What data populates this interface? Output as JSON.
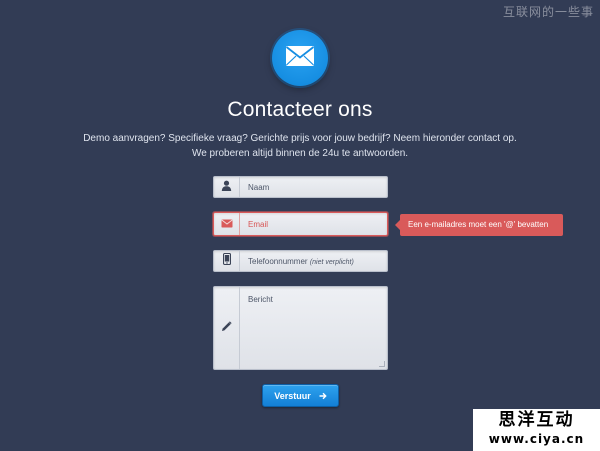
{
  "watermark": {
    "top_text": "互联网的一些事",
    "box_line1": "思洋互动",
    "box_line2": "www.ciya.cn"
  },
  "header": {
    "icon": "envelope-icon",
    "title": "Contacteer ons",
    "intro_line1": "Demo aanvragen? Specifieke vraag? Gerichte prijs voor jouw bedrijf? Neem hieronder contact op.",
    "intro_line2": "We proberen altijd binnen de 24u te antwoorden."
  },
  "form": {
    "name": {
      "placeholder": "Naam",
      "icon": "user-icon"
    },
    "email": {
      "placeholder": "Email",
      "icon": "envelope-icon",
      "state": "error"
    },
    "phone": {
      "placeholder": "Telefoonnummer",
      "optional_note": "(niet verplicht)",
      "icon": "phone-icon"
    },
    "message": {
      "placeholder": "Bericht",
      "icon": "pencil-icon"
    },
    "error_tooltip": "Een e-mailadres moet een '@' bevatten",
    "submit_label": "Verstuur",
    "submit_icon": "arrow-right-icon"
  },
  "colors": {
    "background": "#323c55",
    "accent": "#168ee2",
    "error": "#d95a5a",
    "field_bg": "#e6e8ee"
  }
}
